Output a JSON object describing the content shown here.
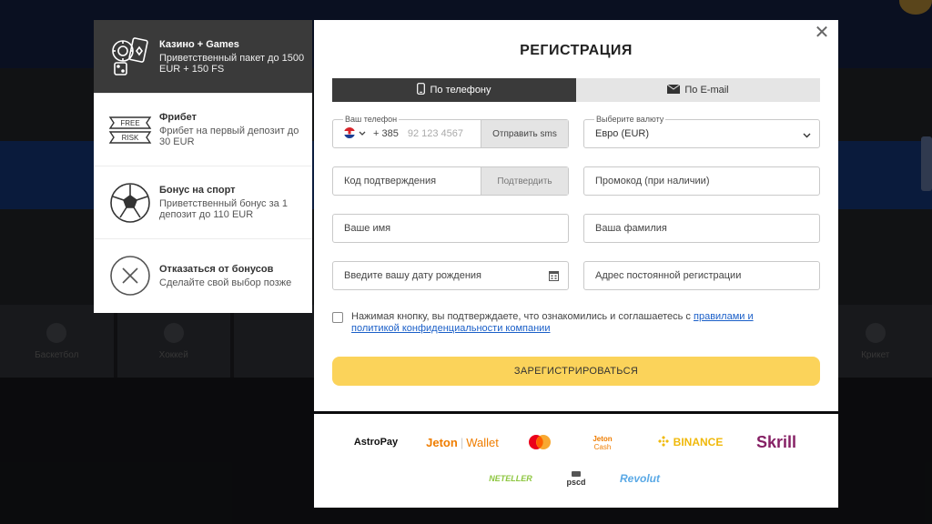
{
  "bonuses": [
    {
      "title": "Казино + Games",
      "desc": "Приветственный пакет до 1500 EUR + 150 FS",
      "icon": "casino-chips-icon",
      "active": true
    },
    {
      "title": "Фрибет",
      "desc": "Фрибет на первый депозит до 30 EUR",
      "icon": "free-risk-icon",
      "icon_text_1": "FREE",
      "icon_text_2": "RISK"
    },
    {
      "title": "Бонус на спорт",
      "desc": "Приветственный бонус за 1 депозит до 110 EUR",
      "icon": "soccer-ball-icon"
    },
    {
      "title": "Отказаться от бонусов",
      "desc": "Сделайте свой выбор позже",
      "icon": "decline-x-icon"
    }
  ],
  "modal": {
    "title": "РЕГИСТРАЦИЯ",
    "close": "✕",
    "tabs": [
      {
        "label": "По телефону",
        "icon": "phone-icon",
        "active": true
      },
      {
        "label": "По E-mail",
        "icon": "envelope-icon",
        "active": false
      }
    ],
    "phone": {
      "label": "Ваш телефон",
      "code": "+ 385",
      "placeholder": "92 123 4567",
      "send_sms": "Отправить sms",
      "flag": "croatia-flag-icon"
    },
    "currency": {
      "label": "Выберите валюту",
      "value": "Евро (EUR)"
    },
    "confirm_code": {
      "placeholder": "Код подтверждения",
      "button": "Подтвердить"
    },
    "promo": {
      "placeholder": "Промокод (при наличии)"
    },
    "first_name": {
      "placeholder": "Ваше имя"
    },
    "last_name": {
      "placeholder": "Ваша фамилия"
    },
    "birth_date": {
      "placeholder": "Введите вашу дату рождения"
    },
    "address": {
      "placeholder": "Адрес постоянной регистрации"
    },
    "consent_text": "Нажимая кнопку, вы подтверждаете, что ознакомились и соглашаетесь с ",
    "consent_link": "правилами и политикой конфиденциальности компании",
    "submit": "ЗАРЕГИСТРИРОВАТЬСЯ"
  },
  "payments": {
    "astropay": "AstroPay",
    "jeton_wallet_1": "Jeton",
    "jeton_wallet_2": "Wallet",
    "jeton_cash_1": "Jeton",
    "jeton_cash_2": "Cash",
    "binance": "BINANCE",
    "skrill": "Skrill",
    "neteller": "NETELLER",
    "pscd": "pscd",
    "revolut": "Revolut"
  },
  "background": {
    "tiles": [
      "Баскетбол",
      "Хоккей",
      "",
      "",
      "",
      "",
      "",
      "Крикет"
    ]
  },
  "colors": {
    "accent": "#fbd35a",
    "dark": "#3a3a3a",
    "link": "#1a5fc8"
  }
}
